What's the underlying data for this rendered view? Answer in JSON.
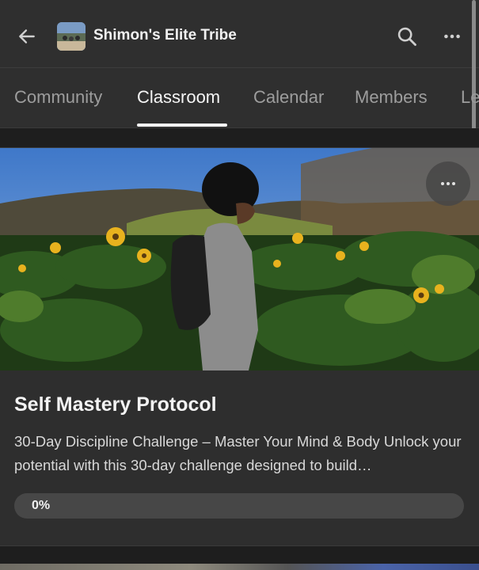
{
  "header": {
    "title": "Shimon's Elite Tribe",
    "back_icon": "arrow-left-icon",
    "search_icon": "search-icon",
    "more_icon": "more-horizontal-icon"
  },
  "tabs": [
    {
      "label": "Community",
      "active": false
    },
    {
      "label": "Classroom",
      "active": true
    },
    {
      "label": "Calendar",
      "active": false
    },
    {
      "label": "Members",
      "active": false
    },
    {
      "label": "Le",
      "active": false
    }
  ],
  "course": {
    "title": "Self Mastery Protocol",
    "description": "30-Day Discipline Challenge – Master Your Mind & Body Unlock your potential with this 30-day challenge designed to build…",
    "progress": 0,
    "progress_label": "0%",
    "menu_icon": "more-horizontal-icon"
  },
  "colors": {
    "background": "#1e1e1e",
    "surface": "#2f2f2f",
    "card": "#2e2e2e",
    "progress_track": "#474747"
  }
}
